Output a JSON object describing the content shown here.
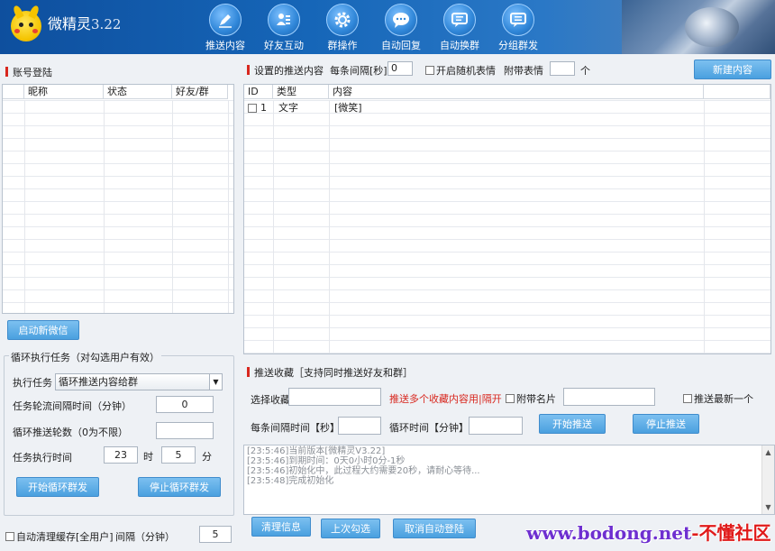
{
  "app": {
    "name": "微精灵",
    "version": "3.22"
  },
  "nav": [
    {
      "label": "推送内容",
      "icon": "pen-icon"
    },
    {
      "label": "好友互动",
      "icon": "users-icon"
    },
    {
      "label": "群操作",
      "icon": "gear-icon"
    },
    {
      "label": "自动回复",
      "icon": "chat-icon"
    },
    {
      "label": "自动换群",
      "icon": "message-swap-icon"
    },
    {
      "label": "分组群发",
      "icon": "message-group-icon"
    }
  ],
  "account": {
    "title": "账号登陆",
    "columns": [
      "昵称",
      "状态",
      "好友/群"
    ],
    "launch_button": "启动新微信"
  },
  "loop_task": {
    "title": "循环执行任务（对勾选用户有效）",
    "task_label": "执行任务",
    "task_value": "循环推送内容给群",
    "interval_label": "任务轮流间隔时间（分钟）",
    "interval_value": "0",
    "rounds_label": "循环推送轮数（0为不限）",
    "rounds_value": "",
    "exec_time_label": "任务执行时间",
    "hour_value": "23",
    "hour_unit": "时",
    "minute_value": "5",
    "minute_unit": "分",
    "start_button": "开始循环群发",
    "stop_button": "停止循环群发"
  },
  "auto_clean": {
    "label": "自动清理缓存[全用户]",
    "interval_label": "间隔（分钟）",
    "interval_value": "5"
  },
  "push_content": {
    "title": "设置的推送内容",
    "interval_label": "每条间隔[秒]",
    "interval_value": "0",
    "random_emoji_label": "开启随机表情",
    "attach_emoji_label": "附带表情",
    "attach_emoji_unit": "个",
    "new_button": "新建内容",
    "columns": [
      "ID",
      "类型",
      "内容"
    ],
    "rows": [
      {
        "id": "1",
        "type": "文字",
        "content": "[微笑]"
      }
    ]
  },
  "push_collect": {
    "title": "推送收藏［支持同时推送好友和群］",
    "select_label": "选择收藏",
    "multi_hint": "推送多个收藏内容用|隔开",
    "card_label": "附带名片",
    "latest_label": "推送最新一个",
    "each_interval_label": "每条间隔时间【秒】",
    "loop_time_label": "循环时间【分钟】",
    "start_button": "开始推送",
    "stop_button": "停止推送"
  },
  "log": [
    "[23:5:46]当前版本[微精灵V3.22]",
    "[23:5:46]到期时间：0天0小时0分-1秒",
    "[23:5:46]初始化中，此过程大约需要20秒，请耐心等待...",
    "[23:5:48]完成初始化"
  ],
  "bottom_buttons": {
    "clear": "清理信息",
    "last_check": "上次勾选",
    "cancel_login": "取消自动登陆"
  },
  "watermark": {
    "part1": "www.bodong.net",
    "part2": "-不懂社区"
  }
}
